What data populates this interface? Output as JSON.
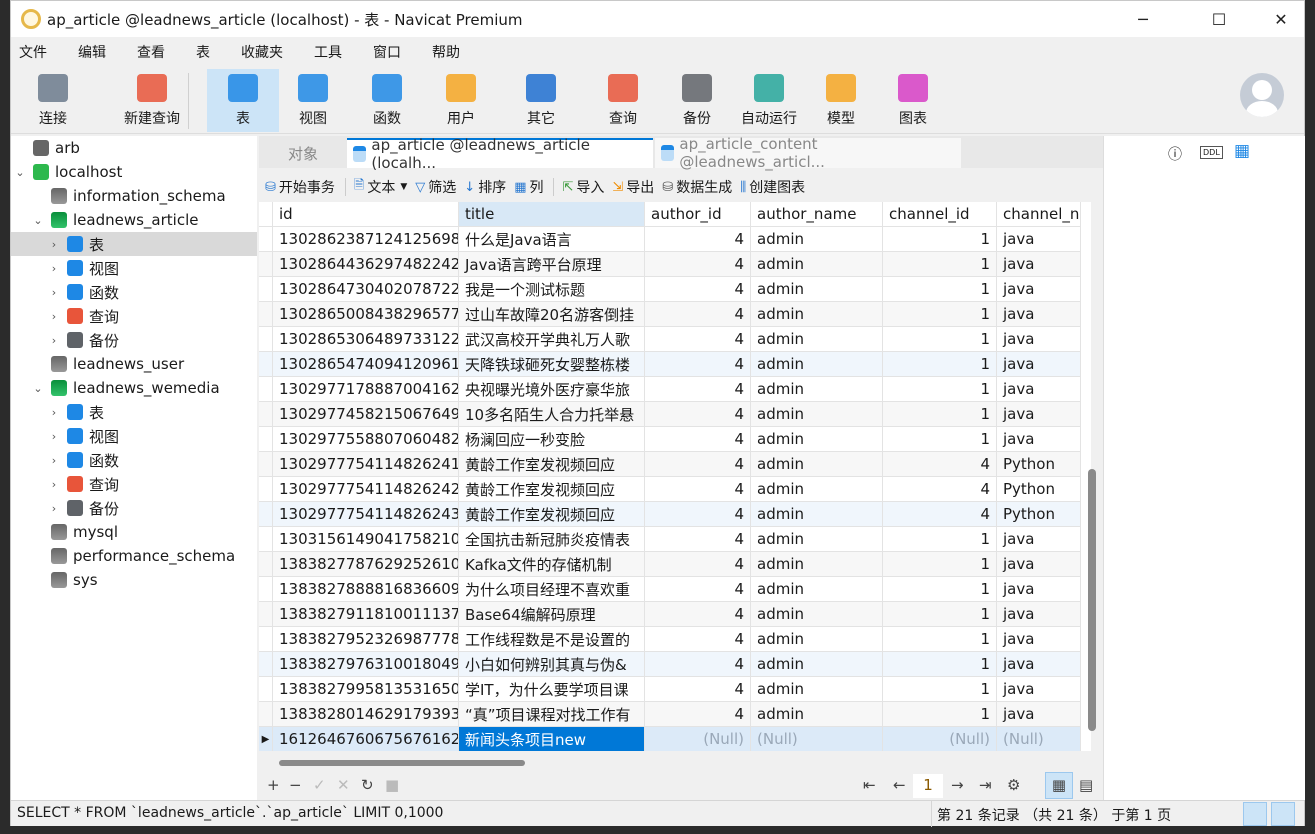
{
  "window": {
    "title": "ap_article @leadnews_article (localhost) - 表 - Navicat Premium",
    "minimize": "─",
    "maximize": "☐",
    "close": "✕"
  },
  "menu": [
    "文件",
    "编辑",
    "查看",
    "表",
    "收藏夹",
    "工具",
    "窗口",
    "帮助"
  ],
  "toolbar": [
    {
      "label": "连接",
      "icon": "plug-icon",
      "color": "#6b7a8c"
    },
    {
      "label": "新建查询",
      "icon": "new-query-icon",
      "color": "#e8553a"
    },
    {
      "label": "表",
      "icon": "table-icon",
      "color": "#1e88e5",
      "active": true
    },
    {
      "label": "视图",
      "icon": "view-icon",
      "color": "#1e88e5"
    },
    {
      "label": "函数",
      "icon": "function-icon",
      "color": "#1e88e5"
    },
    {
      "label": "用户",
      "icon": "user-icon",
      "color": "#f5a623"
    },
    {
      "label": "其它",
      "icon": "tools-icon",
      "color": "#1e6fd0"
    },
    {
      "label": "查询",
      "icon": "query-icon",
      "color": "#e8553a"
    },
    {
      "label": "备份",
      "icon": "backup-icon",
      "color": "#5f6368"
    },
    {
      "label": "自动运行",
      "icon": "robot-icon",
      "color": "#26a69a"
    },
    {
      "label": "模型",
      "icon": "model-icon",
      "color": "#f5a623"
    },
    {
      "label": "图表",
      "icon": "chart-icon",
      "color": "#d63ec4"
    }
  ],
  "sidebar": [
    {
      "label": "arb",
      "level": 0,
      "icon": "connection-icon",
      "chev": ""
    },
    {
      "label": "localhost",
      "level": 0,
      "icon": "connection-active-icon",
      "chev": "⌄"
    },
    {
      "label": "information_schema",
      "level": 1,
      "icon": "database-icon",
      "chev": ""
    },
    {
      "label": "leadnews_article",
      "level": 1,
      "icon": "database-active-icon",
      "chev": "⌄"
    },
    {
      "label": "表",
      "level": 2,
      "icon": "table-icon",
      "chev": "›",
      "selected": true
    },
    {
      "label": "视图",
      "level": 2,
      "icon": "view-icon",
      "chev": "›"
    },
    {
      "label": "函数",
      "level": 2,
      "icon": "function-icon",
      "chev": "›"
    },
    {
      "label": "查询",
      "level": 2,
      "icon": "query-icon",
      "chev": "›"
    },
    {
      "label": "备份",
      "level": 2,
      "icon": "backup-icon",
      "chev": "›"
    },
    {
      "label": "leadnews_user",
      "level": 1,
      "icon": "database-icon",
      "chev": ""
    },
    {
      "label": "leadnews_wemedia",
      "level": 1,
      "icon": "database-active-icon",
      "chev": "⌄"
    },
    {
      "label": "表",
      "level": 2,
      "icon": "table-icon",
      "chev": "›"
    },
    {
      "label": "视图",
      "level": 2,
      "icon": "view-icon",
      "chev": "›"
    },
    {
      "label": "函数",
      "level": 2,
      "icon": "function-icon",
      "chev": "›"
    },
    {
      "label": "查询",
      "level": 2,
      "icon": "query-icon",
      "chev": "›"
    },
    {
      "label": "备份",
      "level": 2,
      "icon": "backup-icon",
      "chev": "›"
    },
    {
      "label": "mysql",
      "level": 1,
      "icon": "database-icon",
      "chev": ""
    },
    {
      "label": "performance_schema",
      "level": 1,
      "icon": "database-icon",
      "chev": ""
    },
    {
      "label": "sys",
      "level": 1,
      "icon": "database-icon",
      "chev": ""
    }
  ],
  "tabs": {
    "objects": "对象",
    "tab1": "ap_article @leadnews_article (localh...",
    "tab2": "ap_article_content @leadnews_articl..."
  },
  "right_icons": {
    "info": "ⓘ",
    "ddl": "DDL",
    "grid": "▦"
  },
  "table_toolbar": {
    "begin_tx": "开始事务",
    "text": "文本",
    "filter": "筛选",
    "sort": "排序",
    "columns": "列",
    "import": "导入",
    "export": "导出",
    "generate": "数据生成",
    "create_chart": "创建图表"
  },
  "columns": [
    "id",
    "title",
    "author_id",
    "author_name",
    "channel_id",
    "channel_n"
  ],
  "rows": [
    [
      "1302862387124125698",
      "什么是Java语言",
      "4",
      "admin",
      "1",
      "java"
    ],
    [
      "1302864436297482242",
      "Java语言跨平台原理",
      "4",
      "admin",
      "1",
      "java"
    ],
    [
      "1302864730402078722",
      "我是一个测试标题",
      "4",
      "admin",
      "1",
      "java"
    ],
    [
      "1302865008438296577",
      "过山车故障20名游客倒挂",
      "4",
      "admin",
      "1",
      "java"
    ],
    [
      "1302865306489733122",
      "武汉高校开学典礼万人歌",
      "4",
      "admin",
      "1",
      "java"
    ],
    [
      "1302865474094120961",
      "天降铁球砸死女婴整栋楼",
      "4",
      "admin",
      "1",
      "java"
    ],
    [
      "1302977178887004162",
      "央视曝光境外医疗豪华旅",
      "4",
      "admin",
      "1",
      "java"
    ],
    [
      "1302977458215067649",
      "10多名陌生人合力托举悬",
      "4",
      "admin",
      "1",
      "java"
    ],
    [
      "1302977558807060482",
      "杨澜回应一秒变脸",
      "4",
      "admin",
      "1",
      "java"
    ],
    [
      "1302977754114826241",
      "黄龄工作室发视频回应",
      "4",
      "admin",
      "4",
      "Python"
    ],
    [
      "1302977754114826242",
      "黄龄工作室发视频回应",
      "4",
      "admin",
      "4",
      "Python"
    ],
    [
      "1302977754114826243",
      "黄龄工作室发视频回应",
      "4",
      "admin",
      "4",
      "Python"
    ],
    [
      "1303156149041758210",
      "全国抗击新冠肺炎疫情表",
      "4",
      "admin",
      "1",
      "java"
    ],
    [
      "1383827787629252610",
      "Kafka文件的存储机制",
      "4",
      "admin",
      "1",
      "java"
    ],
    [
      "1383827888816836609",
      "为什么项目经理不喜欢重",
      "4",
      "admin",
      "1",
      "java"
    ],
    [
      "1383827911810011137",
      "Base64编解码原理",
      "4",
      "admin",
      "1",
      "java"
    ],
    [
      "1383827952326987778",
      "工作线程数是不是设置的",
      "4",
      "admin",
      "1",
      "java"
    ],
    [
      "1383827976310018049",
      "小白如何辨别其真与伪&",
      "4",
      "admin",
      "1",
      "java"
    ],
    [
      "1383827995813531650",
      "学IT，为什么要学项目课",
      "4",
      "admin",
      "1",
      "java"
    ],
    [
      "1383828014629179393",
      "“真”项目课程对找工作有",
      "4",
      "admin",
      "1",
      "java"
    ],
    [
      "1612646760675676162",
      "新闻头条项目new",
      "(Null)",
      "(Null)",
      "(Null)",
      "(Null)"
    ]
  ],
  "nav": {
    "add": "+",
    "remove": "−",
    "apply": "✓",
    "discard": "✕",
    "refresh": "↻",
    "stop": "■",
    "first": "⇤",
    "prev": "←",
    "page": "1",
    "next": "→",
    "last": "⇥",
    "settings": "⚙",
    "grid_view": "▦",
    "form_view": "▤"
  },
  "status": {
    "sql": "SELECT * FROM `leadnews_article`.`ap_article` LIMIT 0,1000",
    "record": "第 21 条记录 （共 21 条） 于第 1 页"
  },
  "colors": {
    "accent": "#0078d7",
    "selected_row": "#dceaf8",
    "active_tool": "#cce4f7"
  }
}
